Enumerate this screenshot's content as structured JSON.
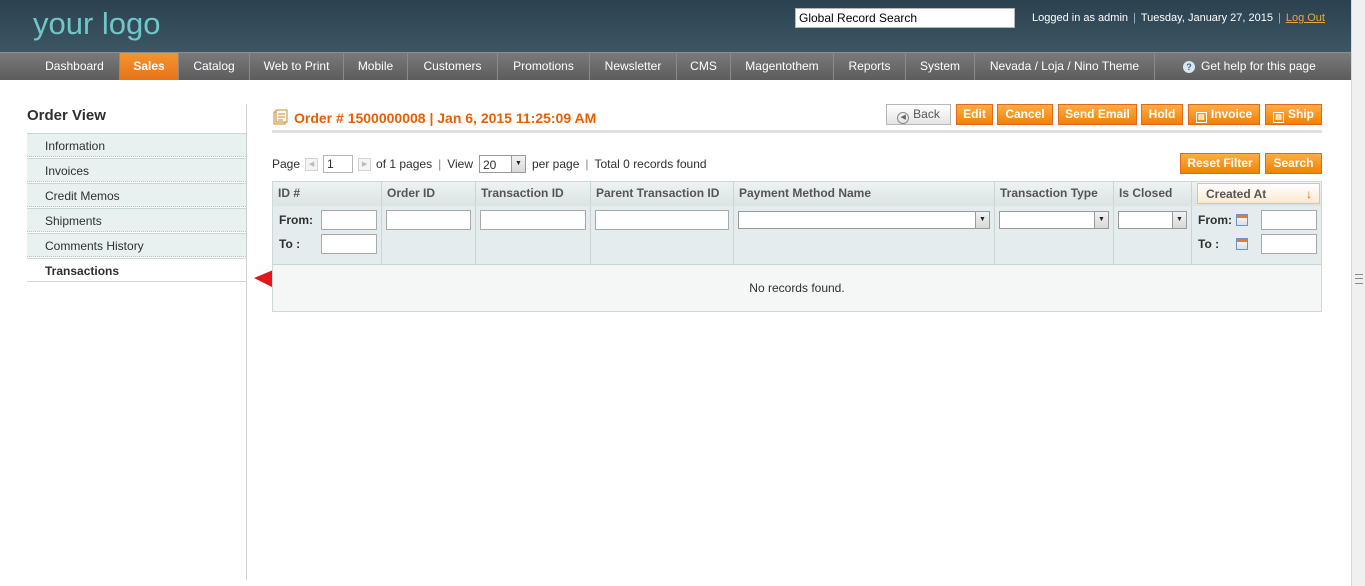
{
  "header": {
    "logo_text": "your logo",
    "search_value": "Global Record Search",
    "logged_in_text": "Logged in as admin",
    "date_text": "Tuesday, January 27, 2015",
    "logout_label": "Log Out"
  },
  "nav": {
    "items": [
      "Dashboard",
      "Sales",
      "Catalog",
      "Web to Print",
      "Mobile",
      "Customers",
      "Promotions",
      "Newsletter",
      "CMS",
      "Magentothem",
      "Reports",
      "System",
      "Nevada / Loja / Nino Theme"
    ],
    "active": "Sales",
    "help_label": "Get help for this page"
  },
  "sidebar": {
    "title": "Order View",
    "items": [
      "Information",
      "Invoices",
      "Credit Memos",
      "Shipments",
      "Comments History",
      "Transactions"
    ],
    "active": "Transactions"
  },
  "order": {
    "title": "Order # 1500000008 | Jan 6, 2015 11:25:09 AM",
    "buttons": {
      "back": "Back",
      "edit": "Edit",
      "cancel": "Cancel",
      "send_email": "Send Email",
      "hold": "Hold",
      "invoice": "Invoice",
      "ship": "Ship"
    }
  },
  "pager": {
    "page_label": "Page",
    "page_value": "1",
    "of_pages": "of 1 pages",
    "view_label": "View",
    "view_value": "20",
    "per_page": "per page",
    "total": "Total 0 records found",
    "reset_filter": "Reset Filter",
    "search": "Search"
  },
  "grid": {
    "columns": [
      "ID #",
      "Order ID",
      "Transaction ID",
      "Parent Transaction ID",
      "Payment Method Name",
      "Transaction Type",
      "Is Closed",
      "Created At"
    ],
    "sorted_column": "Created At",
    "from_label": "From:",
    "to_label": "To :",
    "empty_text": "No records found."
  },
  "colors": {
    "accent_orange": "#eb5e00",
    "header_bg": "#2b4150",
    "nav_bg": "#6a6a6a",
    "logo": "#6ec8c8",
    "arrow": "#e0161b"
  },
  "icons": {
    "order": "order-doc-icon",
    "help": "help-circle-icon",
    "back": "back-arrow-icon",
    "calendar": "calendar-icon",
    "sort": "sort-down-arrow-icon"
  }
}
